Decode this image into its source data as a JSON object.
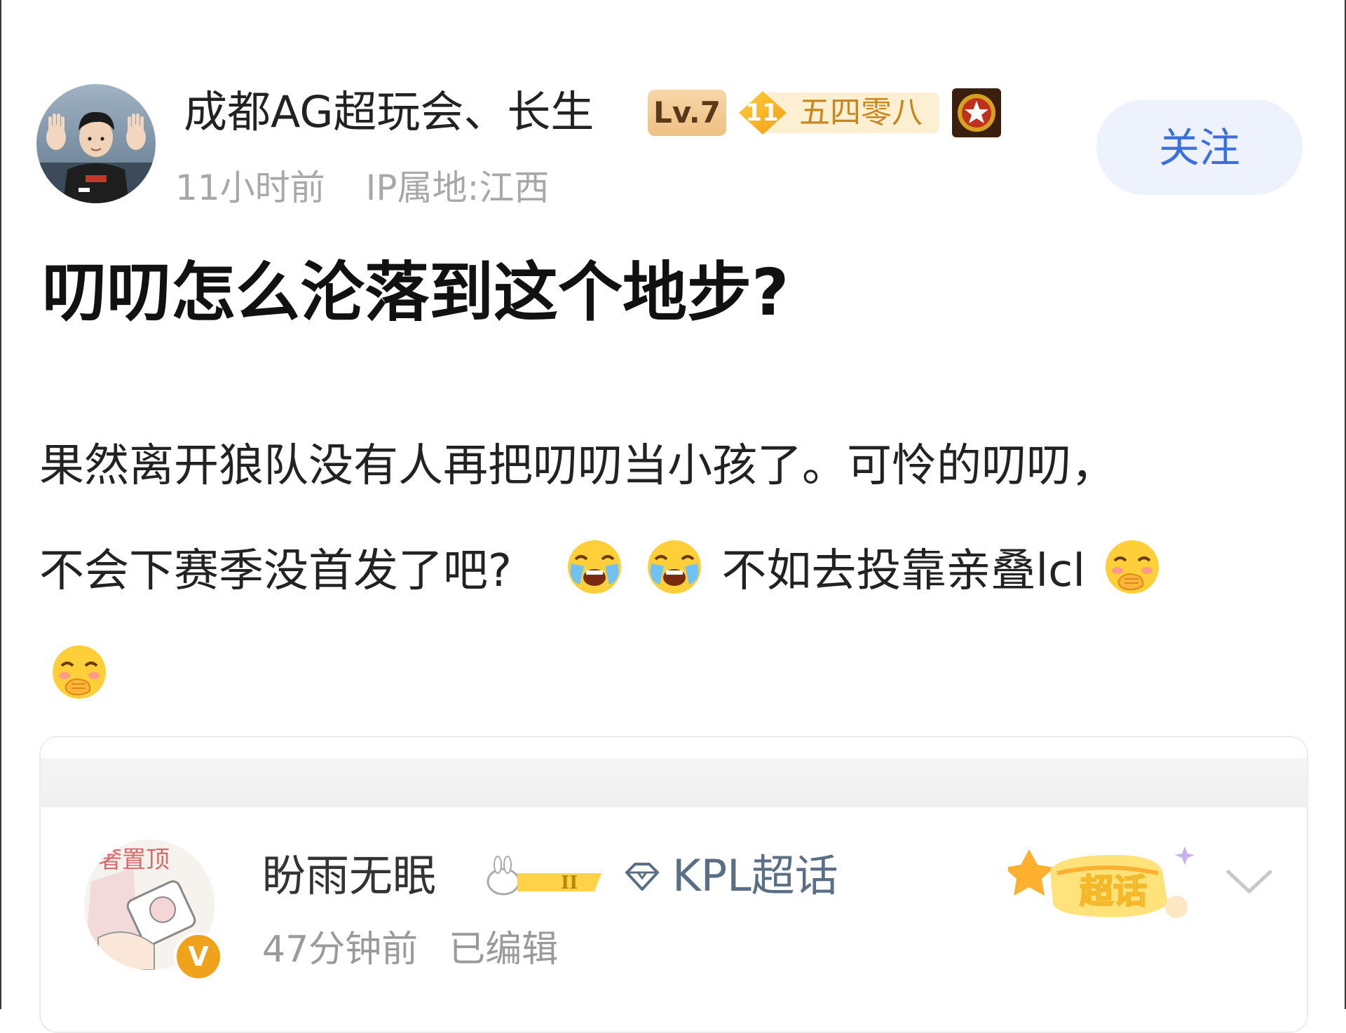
{
  "post": {
    "author": {
      "name": "成都AG超玩会、长生",
      "level_badge": "Lv.7",
      "fan_badge_number": "11",
      "fan_badge_text": "五四零八",
      "avatar_icon": "player-avatar",
      "star_icon": "star-medal-icon"
    },
    "meta": {
      "time": "11小时前",
      "ip_location": "IP属地:江西"
    },
    "follow_label": "关注",
    "title": "叨叨怎么沦落到这个地步?",
    "body": {
      "line1": "果然离开狼队没有人再把叨叨当小孩了。可怜的叨叨，",
      "line2_a": "不会下赛季没首发了吧?",
      "line2_b": "不如去投靠亲叠lcl",
      "emoji_cry": "crying-emoji",
      "emoji_giggle": "giggle-emoji"
    }
  },
  "quoted": {
    "author_name": "盼雨无眠",
    "rank_badge": "II",
    "topic": "KPL超话",
    "sticker_text": "超话",
    "verified_badge": "V",
    "time": "47分钟前",
    "edited": "已编辑"
  },
  "colors": {
    "follow_text": "#3b6fe0",
    "follow_bg": "#edf2fd",
    "meta_gray": "#a8a8a8",
    "fan_badge_gold": "#f0a21b"
  }
}
